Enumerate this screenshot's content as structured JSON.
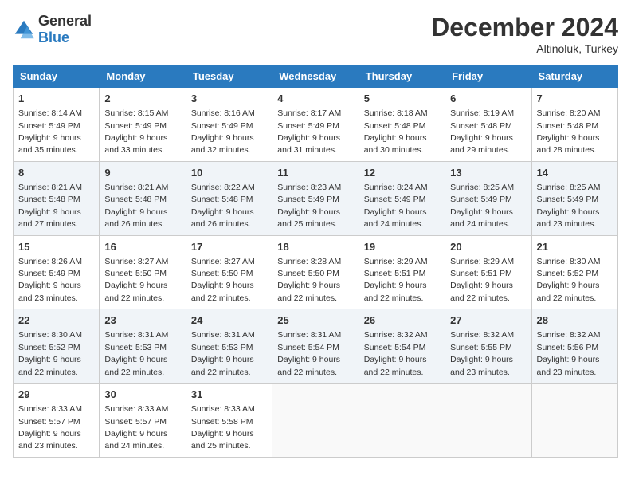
{
  "header": {
    "logo_general": "General",
    "logo_blue": "Blue",
    "month": "December 2024",
    "location": "Altinoluk, Turkey"
  },
  "days_of_week": [
    "Sunday",
    "Monday",
    "Tuesday",
    "Wednesday",
    "Thursday",
    "Friday",
    "Saturday"
  ],
  "weeks": [
    [
      {
        "day": 1,
        "sunrise": "8:14 AM",
        "sunset": "5:49 PM",
        "daylight": "9 hours and 35 minutes."
      },
      {
        "day": 2,
        "sunrise": "8:15 AM",
        "sunset": "5:49 PM",
        "daylight": "9 hours and 33 minutes."
      },
      {
        "day": 3,
        "sunrise": "8:16 AM",
        "sunset": "5:49 PM",
        "daylight": "9 hours and 32 minutes."
      },
      {
        "day": 4,
        "sunrise": "8:17 AM",
        "sunset": "5:49 PM",
        "daylight": "9 hours and 31 minutes."
      },
      {
        "day": 5,
        "sunrise": "8:18 AM",
        "sunset": "5:48 PM",
        "daylight": "9 hours and 30 minutes."
      },
      {
        "day": 6,
        "sunrise": "8:19 AM",
        "sunset": "5:48 PM",
        "daylight": "9 hours and 29 minutes."
      },
      {
        "day": 7,
        "sunrise": "8:20 AM",
        "sunset": "5:48 PM",
        "daylight": "9 hours and 28 minutes."
      }
    ],
    [
      {
        "day": 8,
        "sunrise": "8:21 AM",
        "sunset": "5:48 PM",
        "daylight": "9 hours and 27 minutes."
      },
      {
        "day": 9,
        "sunrise": "8:21 AM",
        "sunset": "5:48 PM",
        "daylight": "9 hours and 26 minutes."
      },
      {
        "day": 10,
        "sunrise": "8:22 AM",
        "sunset": "5:48 PM",
        "daylight": "9 hours and 26 minutes."
      },
      {
        "day": 11,
        "sunrise": "8:23 AM",
        "sunset": "5:49 PM",
        "daylight": "9 hours and 25 minutes."
      },
      {
        "day": 12,
        "sunrise": "8:24 AM",
        "sunset": "5:49 PM",
        "daylight": "9 hours and 24 minutes."
      },
      {
        "day": 13,
        "sunrise": "8:25 AM",
        "sunset": "5:49 PM",
        "daylight": "9 hours and 24 minutes."
      },
      {
        "day": 14,
        "sunrise": "8:25 AM",
        "sunset": "5:49 PM",
        "daylight": "9 hours and 23 minutes."
      }
    ],
    [
      {
        "day": 15,
        "sunrise": "8:26 AM",
        "sunset": "5:49 PM",
        "daylight": "9 hours and 23 minutes."
      },
      {
        "day": 16,
        "sunrise": "8:27 AM",
        "sunset": "5:50 PM",
        "daylight": "9 hours and 22 minutes."
      },
      {
        "day": 17,
        "sunrise": "8:27 AM",
        "sunset": "5:50 PM",
        "daylight": "9 hours and 22 minutes."
      },
      {
        "day": 18,
        "sunrise": "8:28 AM",
        "sunset": "5:50 PM",
        "daylight": "9 hours and 22 minutes."
      },
      {
        "day": 19,
        "sunrise": "8:29 AM",
        "sunset": "5:51 PM",
        "daylight": "9 hours and 22 minutes."
      },
      {
        "day": 20,
        "sunrise": "8:29 AM",
        "sunset": "5:51 PM",
        "daylight": "9 hours and 22 minutes."
      },
      {
        "day": 21,
        "sunrise": "8:30 AM",
        "sunset": "5:52 PM",
        "daylight": "9 hours and 22 minutes."
      }
    ],
    [
      {
        "day": 22,
        "sunrise": "8:30 AM",
        "sunset": "5:52 PM",
        "daylight": "9 hours and 22 minutes."
      },
      {
        "day": 23,
        "sunrise": "8:31 AM",
        "sunset": "5:53 PM",
        "daylight": "9 hours and 22 minutes."
      },
      {
        "day": 24,
        "sunrise": "8:31 AM",
        "sunset": "5:53 PM",
        "daylight": "9 hours and 22 minutes."
      },
      {
        "day": 25,
        "sunrise": "8:31 AM",
        "sunset": "5:54 PM",
        "daylight": "9 hours and 22 minutes."
      },
      {
        "day": 26,
        "sunrise": "8:32 AM",
        "sunset": "5:54 PM",
        "daylight": "9 hours and 22 minutes."
      },
      {
        "day": 27,
        "sunrise": "8:32 AM",
        "sunset": "5:55 PM",
        "daylight": "9 hours and 23 minutes."
      },
      {
        "day": 28,
        "sunrise": "8:32 AM",
        "sunset": "5:56 PM",
        "daylight": "9 hours and 23 minutes."
      }
    ],
    [
      {
        "day": 29,
        "sunrise": "8:33 AM",
        "sunset": "5:57 PM",
        "daylight": "9 hours and 23 minutes."
      },
      {
        "day": 30,
        "sunrise": "8:33 AM",
        "sunset": "5:57 PM",
        "daylight": "9 hours and 24 minutes."
      },
      {
        "day": 31,
        "sunrise": "8:33 AM",
        "sunset": "5:58 PM",
        "daylight": "9 hours and 25 minutes."
      },
      null,
      null,
      null,
      null
    ]
  ]
}
